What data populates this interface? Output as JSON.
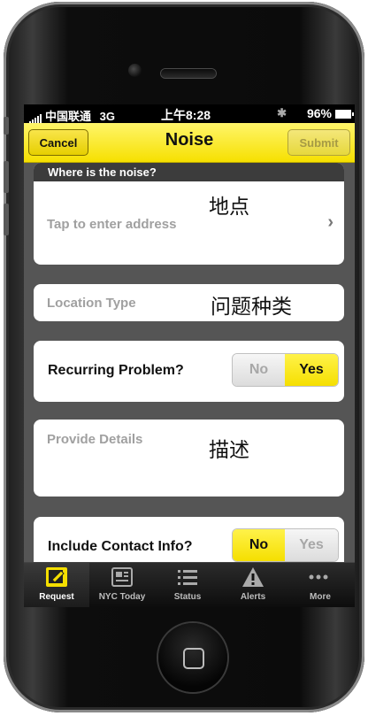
{
  "status": {
    "carrier": "中国联通",
    "network": "3G",
    "time": "上午8:28",
    "battery": "96%"
  },
  "nav": {
    "cancel": "Cancel",
    "title": "Noise",
    "submit": "Submit"
  },
  "location": {
    "header": "Where is the noise?",
    "placeholder": "Tap to enter address",
    "annotation": "地点"
  },
  "location_type": {
    "placeholder": "Location Type",
    "annotation": "问题种类"
  },
  "recurring": {
    "label": "Recurring Problem?",
    "no": "No",
    "yes": "Yes",
    "selected": "Yes"
  },
  "details": {
    "placeholder": "Provide Details",
    "annotation": "描述"
  },
  "contact": {
    "label": "Include Contact Info?",
    "no": "No",
    "yes": "Yes",
    "selected": "No"
  },
  "tabs": [
    {
      "label": "Request",
      "icon": "compose-icon",
      "active": true
    },
    {
      "label": "NYC Today",
      "icon": "newspaper-icon",
      "active": false
    },
    {
      "label": "Status",
      "icon": "list-icon",
      "active": false
    },
    {
      "label": "Alerts",
      "icon": "warning-icon",
      "active": false
    },
    {
      "label": "More",
      "icon": "more-dots-icon",
      "active": false
    }
  ],
  "colors": {
    "accent": "#f5df00",
    "background": "#555555"
  }
}
